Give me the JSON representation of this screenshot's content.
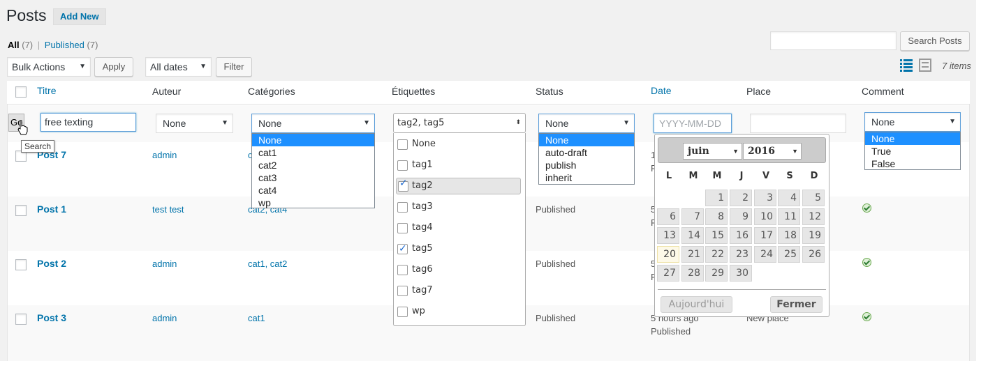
{
  "page": {
    "title": "Posts",
    "add_new": "Add New"
  },
  "subsub": {
    "all": "All",
    "all_count": "(7)",
    "sep": "|",
    "published": "Published",
    "published_count": "(7)"
  },
  "search": {
    "value": "",
    "button": "Search Posts"
  },
  "tablenav": {
    "bulk_actions": "Bulk Actions",
    "apply": "Apply",
    "all_dates": "All dates",
    "filter": "Filter",
    "items": "7 items"
  },
  "columns": {
    "title": "Titre",
    "author": "Auteur",
    "categories": "Catégories",
    "tags": "Étiquettes",
    "status": "Status",
    "date": "Date",
    "place": "Place",
    "comment": "Comment"
  },
  "filters": {
    "go": "Go",
    "go_tooltip": "Search",
    "title_value": "free texting",
    "author_value": "None",
    "category_value": "None",
    "category_options": [
      "None",
      "cat1",
      "cat2",
      "cat3",
      "cat4",
      "wp"
    ],
    "tags_value": "tag2, tag5",
    "tag_options": [
      {
        "label": "None",
        "checked": false
      },
      {
        "label": "tag1",
        "checked": false
      },
      {
        "label": "tag2",
        "checked": true
      },
      {
        "label": "tag3",
        "checked": false
      },
      {
        "label": "tag4",
        "checked": false
      },
      {
        "label": "tag5",
        "checked": true
      },
      {
        "label": "tag6",
        "checked": false
      },
      {
        "label": "tag7",
        "checked": false
      },
      {
        "label": "wp",
        "checked": false
      }
    ],
    "status_value": "None",
    "status_options": [
      "None",
      "auto-draft",
      "publish",
      "inherit"
    ],
    "date_placeholder": "YYYY-MM-DD",
    "place_value": "",
    "comment_value": "None",
    "comment_options": [
      "None",
      "True",
      "False"
    ]
  },
  "datepicker": {
    "month": "juin",
    "year": "2016",
    "weekdays": [
      "L",
      "M",
      "M",
      "J",
      "V",
      "S",
      "D"
    ],
    "days": [
      "1",
      "2",
      "3",
      "4",
      "5",
      "6",
      "7",
      "8",
      "9",
      "10",
      "11",
      "12",
      "13",
      "14",
      "15",
      "16",
      "17",
      "18",
      "19",
      "20",
      "21",
      "22",
      "23",
      "24",
      "25",
      "26",
      "27",
      "28",
      "29",
      "30"
    ],
    "today": "20",
    "today_button": "Aujourd'hui",
    "close_button": "Fermer"
  },
  "rows": [
    {
      "title": "Post 7",
      "author": "admin",
      "categories": "c",
      "status": "",
      "date": "1",
      "date2": "P",
      "place": "",
      "comment": ""
    },
    {
      "title": "Post 1",
      "author": "test test",
      "categories": "cat2, cat4",
      "status": "Published",
      "date": "5",
      "date2": "P",
      "place": "",
      "comment": "check"
    },
    {
      "title": "Post 2",
      "author": "admin",
      "categories": "cat1, cat2",
      "status": "Published",
      "date": "5",
      "date2": "P",
      "place": "",
      "comment": "check"
    },
    {
      "title": "Post 3",
      "author": "admin",
      "categories": "cat1",
      "status": "Published",
      "date": "5 hours ago",
      "date2": "Published",
      "place": "New place",
      "comment": "check"
    }
  ],
  "colors": {
    "link": "#0073aa",
    "highlight": "#1e90ff",
    "background": "#f1f1f1"
  }
}
